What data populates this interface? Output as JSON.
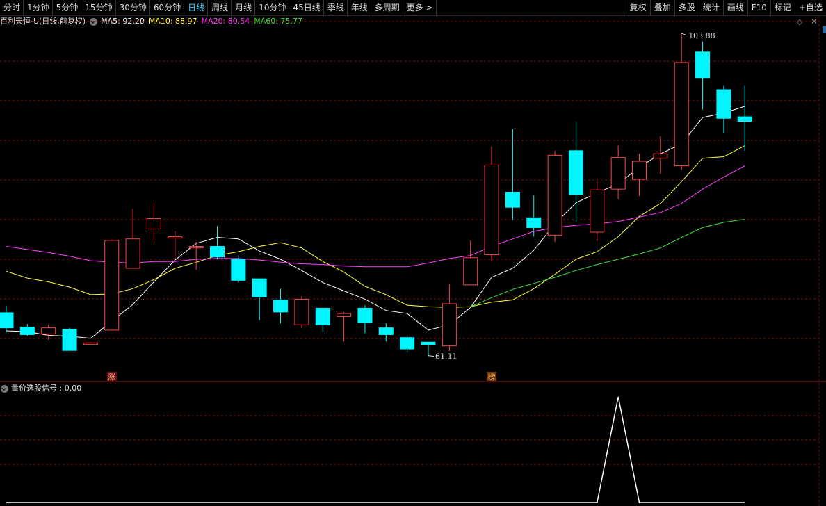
{
  "toolbar": {
    "periods": [
      "分时",
      "1分钟",
      "5分钟",
      "15分钟",
      "30分钟",
      "60分钟",
      "日线",
      "周线",
      "月线",
      "10分钟",
      "45日线",
      "季线",
      "年线",
      "多周期",
      "更多 >"
    ],
    "active_period": "日线",
    "tools": [
      "复权",
      "叠加",
      "多股",
      "统计",
      "画线",
      "F10",
      "标记",
      "+自选"
    ]
  },
  "stock": {
    "title": "百利天恒-U(日线,前复权)",
    "ma5_label": "MA5: 92.20",
    "ma10_label": "MA10: 88.97",
    "ma20_label": "MA20: 80.54",
    "ma60_label": "MA60: 75.77"
  },
  "sub_indicator": {
    "label": "量价选股信号 : 0.00"
  },
  "icons": {
    "toggle": "chevron-down-icon",
    "settings": "diamond-icon",
    "close": "close-icon"
  },
  "colors": {
    "up": "#ff4444",
    "down": "#00f5ff",
    "ma5": "#ffffff",
    "ma10": "#ffff40",
    "ma20": "#ff40ff",
    "ma60": "#40e040",
    "grid": "#7a1010",
    "signal": "#ffffff"
  },
  "chart_data": [
    {
      "type": "candlestick",
      "title": "百利天恒-U(日线,前复权)",
      "price_range": [
        55,
        110
      ],
      "annotations": [
        {
          "text": "103.88",
          "candle_index": 32,
          "kind": "high"
        },
        {
          "text": "61.11",
          "candle_index": 20,
          "kind": "low"
        },
        {
          "text": "涨",
          "candle_index": 5
        },
        {
          "text": "榜",
          "candle_index": 23
        }
      ],
      "candles": [
        {
          "open": 66.8,
          "close": 64.8,
          "high": 67.7,
          "low": 64.2
        },
        {
          "open": 64.9,
          "close": 63.9,
          "high": 65.3,
          "low": 63.7
        },
        {
          "open": 64.0,
          "close": 64.8,
          "high": 65.2,
          "low": 63.2
        },
        {
          "open": 64.6,
          "close": 61.8,
          "high": 64.8,
          "low": 61.8
        },
        {
          "open": 62.8,
          "close": 62.8,
          "high": 62.9,
          "low": 62.6
        },
        {
          "open": 64.5,
          "close": 76.4,
          "high": 76.5,
          "low": 64.5
        },
        {
          "open": 72.7,
          "close": 76.6,
          "high": 80.6,
          "low": 72.7
        },
        {
          "open": 77.9,
          "close": 79.3,
          "high": 81.4,
          "low": 76.0
        },
        {
          "open": 76.8,
          "close": 76.9,
          "high": 77.6,
          "low": 73.9
        },
        {
          "open": 75.4,
          "close": 75.6,
          "high": 76.2,
          "low": 72.5
        },
        {
          "open": 75.6,
          "close": 74.2,
          "high": 78.3,
          "low": 73.9
        },
        {
          "open": 73.9,
          "close": 71.1,
          "high": 74.4,
          "low": 70.8
        },
        {
          "open": 71.3,
          "close": 68.9,
          "high": 71.3,
          "low": 65.8
        },
        {
          "open": 68.5,
          "close": 66.9,
          "high": 70.0,
          "low": 65.4
        },
        {
          "open": 65.2,
          "close": 68.6,
          "high": 69.0,
          "low": 64.8
        },
        {
          "open": 67.4,
          "close": 65.2,
          "high": 67.4,
          "low": 64.3
        },
        {
          "open": 66.3,
          "close": 66.7,
          "high": 66.9,
          "low": 63.0
        },
        {
          "open": 67.4,
          "close": 65.5,
          "high": 67.8,
          "low": 64.1
        },
        {
          "open": 64.8,
          "close": 63.9,
          "high": 65.4,
          "low": 63.0
        },
        {
          "open": 63.5,
          "close": 62.0,
          "high": 63.8,
          "low": 61.5
        },
        {
          "open": 62.9,
          "close": 62.6,
          "high": 62.9,
          "low": 61.11
        },
        {
          "open": 62.4,
          "close": 68.0,
          "high": 70.6,
          "low": 61.7
        },
        {
          "open": 70.5,
          "close": 74.1,
          "high": 76.4,
          "low": 70.5
        },
        {
          "open": 74.5,
          "close": 86.4,
          "high": 88.9,
          "low": 73.6
        },
        {
          "open": 82.8,
          "close": 80.8,
          "high": 91.2,
          "low": 79.1
        },
        {
          "open": 79.4,
          "close": 78.1,
          "high": 82.4,
          "low": 76.9
        },
        {
          "open": 77.1,
          "close": 87.7,
          "high": 88.3,
          "low": 76.2
        },
        {
          "open": 88.3,
          "close": 82.5,
          "high": 92.1,
          "low": 78.9
        },
        {
          "open": 77.5,
          "close": 83.1,
          "high": 84.2,
          "low": 76.3
        },
        {
          "open": 83.2,
          "close": 87.4,
          "high": 89.0,
          "low": 81.9
        },
        {
          "open": 84.5,
          "close": 86.9,
          "high": 87.9,
          "low": 82.3
        },
        {
          "open": 87.3,
          "close": 87.9,
          "high": 90.2,
          "low": 85.2
        },
        {
          "open": 86.3,
          "close": 100.0,
          "high": 103.88,
          "low": 85.8
        },
        {
          "open": 101.4,
          "close": 98.0,
          "high": 102.8,
          "low": 93.8
        },
        {
          "open": 96.4,
          "close": 92.6,
          "high": 96.9,
          "low": 90.6
        },
        {
          "open": 92.8,
          "close": 92.2,
          "high": 96.9,
          "low": 88.3
        }
      ],
      "ma": [
        {
          "name": "MA5",
          "values": [
            64.4,
            64.3,
            63.8,
            63.7,
            63.4,
            65.7,
            67.9,
            70.9,
            73.8,
            76.0,
            76.8,
            76.6,
            75.0,
            73.9,
            72.4,
            70.8,
            69.7,
            68.6,
            67.1,
            66.7,
            64.5,
            65.2,
            67.5,
            71.5,
            72.7,
            75.1,
            78.6,
            81.4,
            82.7,
            83.9,
            86.1,
            87.9,
            89.2,
            92.7,
            93.3,
            94.2
          ]
        },
        {
          "name": "MA10",
          "values": [
            72.3,
            71.4,
            70.9,
            70.2,
            69.2,
            69.3,
            70.0,
            71.2,
            72.7,
            73.5,
            74.4,
            74.9,
            75.6,
            76.1,
            75.4,
            73.6,
            72.2,
            70.3,
            69.2,
            67.8,
            67.6,
            67.5,
            67.6,
            68.2,
            68.5,
            70.0,
            71.9,
            73.9,
            74.9,
            76.9,
            79.6,
            81.3,
            84.2,
            87.3,
            87.5,
            88.97
          ]
        },
        {
          "name": "MA20",
          "values": [
            75.6,
            75.2,
            74.8,
            74.3,
            73.7,
            73.5,
            73.4,
            73.6,
            73.6,
            73.9,
            74.0,
            74.0,
            73.8,
            73.5,
            73.3,
            73.2,
            73.0,
            72.9,
            72.9,
            72.9,
            73.4,
            74.0,
            74.4,
            75.6,
            76.6,
            77.6,
            78.1,
            78.4,
            78.6,
            78.9,
            79.5,
            80.1,
            81.3,
            83.2,
            84.8,
            86.3
          ]
        },
        {
          "name": "MA60",
          "values": [
            null,
            null,
            null,
            null,
            null,
            null,
            null,
            null,
            null,
            null,
            null,
            null,
            null,
            null,
            null,
            null,
            null,
            null,
            null,
            null,
            null,
            null,
            67.6,
            68.8,
            69.9,
            70.7,
            71.5,
            72.4,
            73.2,
            73.9,
            74.6,
            75.4,
            76.8,
            78.1,
            78.8,
            79.2
          ]
        }
      ]
    },
    {
      "type": "line",
      "title": "量价选股信号",
      "ylim": [
        0,
        1
      ],
      "series": [
        {
          "values": [
            0,
            0,
            0,
            0,
            0,
            0,
            0,
            0,
            0,
            0,
            0,
            0,
            0,
            0,
            0,
            0,
            0,
            0,
            0,
            0,
            0,
            0,
            0,
            0,
            0,
            0,
            0,
            0,
            0,
            1,
            0,
            0,
            0,
            0,
            0,
            0
          ]
        }
      ]
    }
  ]
}
